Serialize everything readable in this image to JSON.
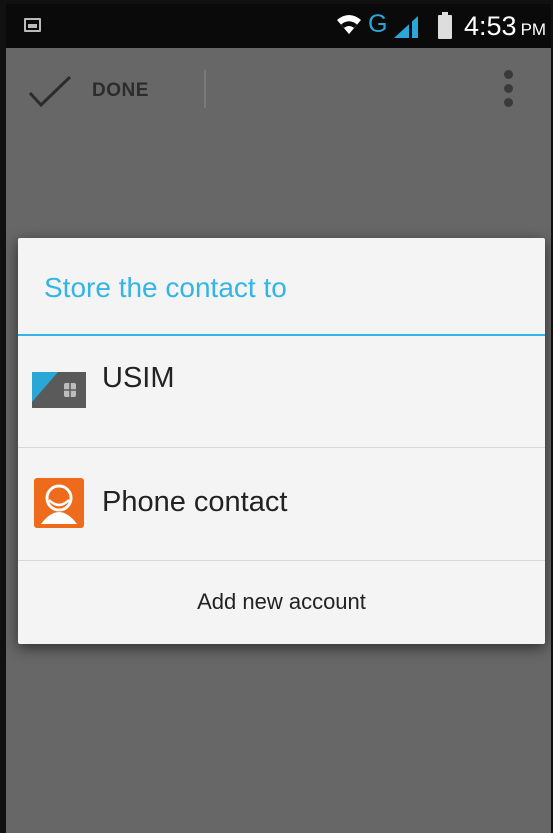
{
  "status_bar": {
    "notification_icon": "image-notification-icon",
    "wifi_icon": "wifi-icon",
    "network_type": "G",
    "signal_icon": "signal-icon",
    "battery_icon": "battery-icon",
    "time": "4:53",
    "ampm": "PM"
  },
  "action_bar": {
    "done_icon": "check-icon",
    "done_label": "DONE",
    "overflow_icon": "overflow-menu-icon"
  },
  "dialog": {
    "title": "Store the contact to",
    "items": [
      {
        "label": "USIM",
        "icon": "sim-card-icon"
      },
      {
        "label": "Phone contact",
        "icon": "phone-contact-icon"
      }
    ],
    "add_account_label": "Add new account"
  },
  "colors": {
    "accent": "#33b5e5",
    "scrim": "#676767",
    "dialog_bg": "#f4f4f4",
    "phone_icon_orange": "#ef6b1c"
  }
}
